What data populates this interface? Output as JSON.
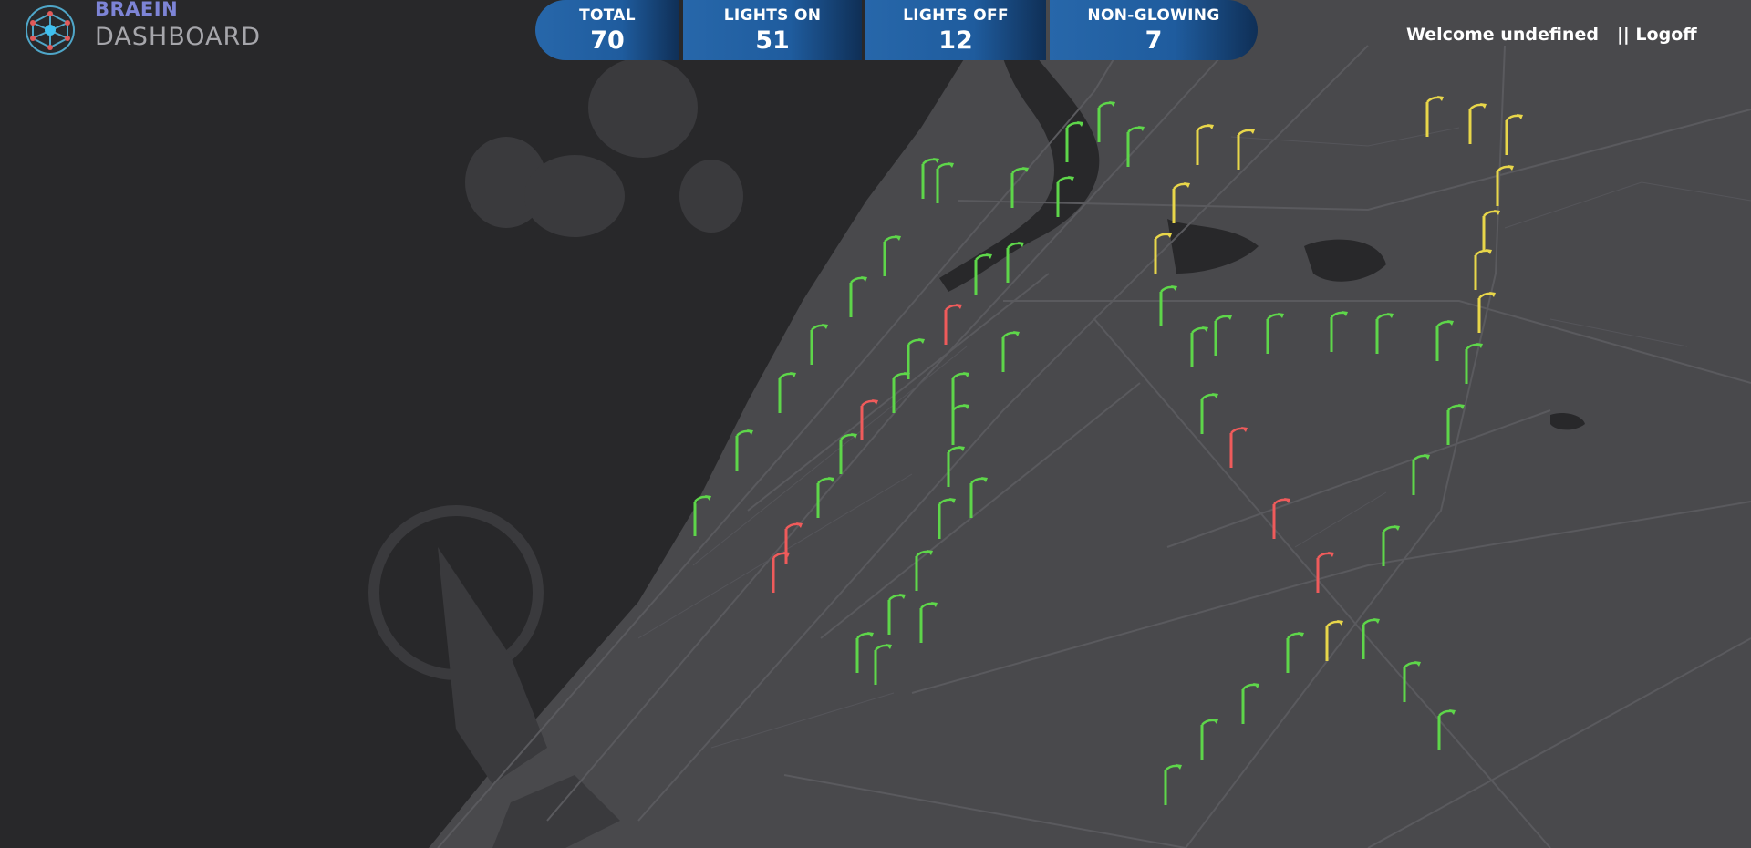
{
  "brand": {
    "title": "BRAEIN",
    "subtitle": "DASHBOARD",
    "logo_icon": "brain-network-icon"
  },
  "stats": [
    {
      "label": "TOTAL",
      "value": "70"
    },
    {
      "label": "LIGHTS ON",
      "value": "51"
    },
    {
      "label": "LIGHTS OFF",
      "value": "12"
    },
    {
      "label": "NON-GLOWING",
      "value": "7"
    }
  ],
  "user": {
    "welcome": "Welcome undefined",
    "logoff": "|| Logoff"
  },
  "colors": {
    "on": "#5ed64a",
    "off": "#ef5b5b",
    "non_glowing": "#e8d64a",
    "sea": "#28282a",
    "land": "#49494c",
    "road": "#5a5a5e"
  },
  "map": {
    "pin_icon": "street-light-icon"
  }
}
